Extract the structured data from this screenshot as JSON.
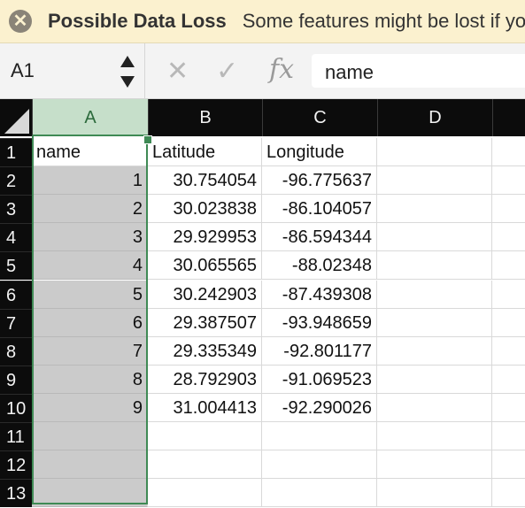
{
  "warning": {
    "icon": "close-icon",
    "title": "Possible Data Loss",
    "message": "Some features might be lost if you save this workbook in the comma-delimited (.csv) format."
  },
  "formula_bar": {
    "name_box": "A1",
    "cancel_glyph": "✕",
    "enter_glyph": "✓",
    "fx_label": "fx",
    "value": "name"
  },
  "columns": [
    "A",
    "B",
    "C",
    "D"
  ],
  "selected_column": "A",
  "rows": [
    {
      "n": "1",
      "a": "name",
      "b": "Latitude",
      "c": "Longitude"
    },
    {
      "n": "2",
      "a": "1",
      "b": "30.754054",
      "c": "-96.775637"
    },
    {
      "n": "3",
      "a": "2",
      "b": "30.023838",
      "c": "-86.104057"
    },
    {
      "n": "4",
      "a": "3",
      "b": "29.929953",
      "c": "-86.594344"
    },
    {
      "n": "5",
      "a": "4",
      "b": "30.065565",
      "c": "-88.02348"
    },
    {
      "n": "6",
      "a": "5",
      "b": "30.242903",
      "c": "-87.439308"
    },
    {
      "n": "7",
      "a": "6",
      "b": "29.387507",
      "c": "-93.948659"
    },
    {
      "n": "8",
      "a": "7",
      "b": "29.335349",
      "c": "-92.801177"
    },
    {
      "n": "9",
      "a": "8",
      "b": "28.792903",
      "c": "-91.069523"
    },
    {
      "n": "10",
      "a": "9",
      "b": "31.004413",
      "c": "-92.290026"
    },
    {
      "n": "11",
      "a": "",
      "b": "",
      "c": ""
    },
    {
      "n": "12",
      "a": "",
      "b": "",
      "c": ""
    },
    {
      "n": "13",
      "a": "",
      "b": "",
      "c": ""
    }
  ],
  "colors": {
    "warning_bg": "#fbf1cf",
    "header_bg": "#0c0c0c",
    "selection_green": "#3f8a55",
    "selected_header_bg": "#c6dfca"
  }
}
